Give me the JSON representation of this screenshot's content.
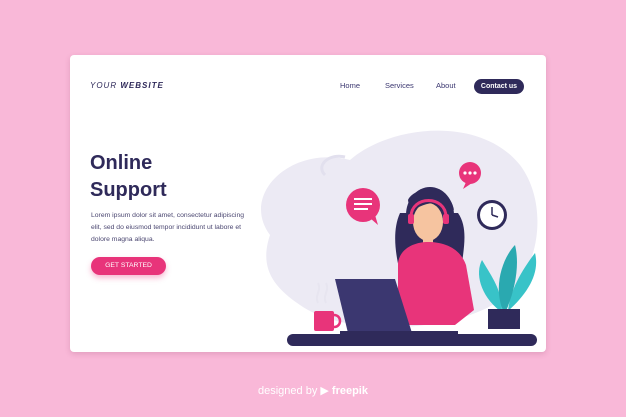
{
  "header": {
    "logo_prefix": "YOUR ",
    "logo_bold": "WEBSITE",
    "nav": [
      "Home",
      "Services",
      "About"
    ],
    "contact_label": "Contact us"
  },
  "hero": {
    "title_line1": "Online",
    "title_line2": "Support",
    "body_line1": "Lorem ipsum dolor sit amet, consectetur adipiscing",
    "body_line2": "elit, sed do eiusmod tempor incididunt ut labore et",
    "body_line3": "dolore magna aliqua.",
    "cta_label": "GET STARTED"
  },
  "footer": {
    "credit_prefix": "designed by ",
    "credit_brand": "freepik"
  },
  "colors": {
    "background": "#f9b8d8",
    "navy": "#2f2a5a",
    "pink": "#e8347a",
    "teal": "#38c3c8"
  },
  "icons": [
    "chat-bubble-icon",
    "typing-bubble-icon",
    "clock-icon",
    "laptop-icon",
    "coffee-cup-icon",
    "plant-icon",
    "headset-icon",
    "freepik-logo-icon"
  ]
}
